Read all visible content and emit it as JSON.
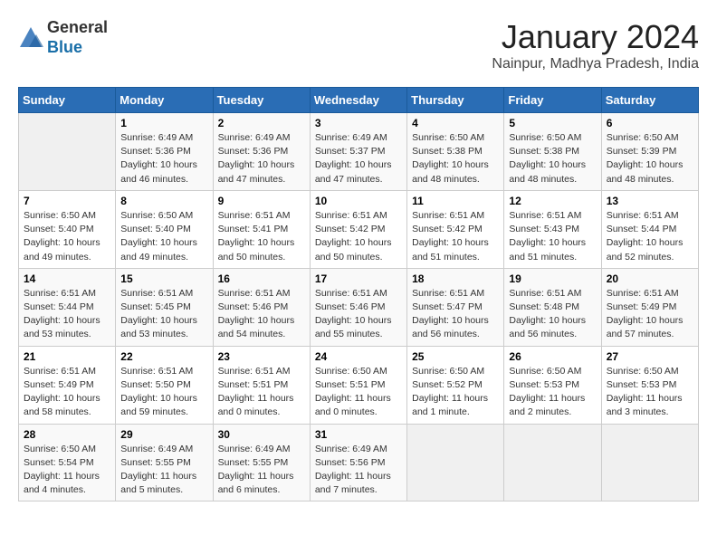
{
  "header": {
    "logo": {
      "line1": "General",
      "line2": "Blue"
    },
    "title": "January 2024",
    "location": "Nainpur, Madhya Pradesh, India"
  },
  "columns": [
    "Sunday",
    "Monday",
    "Tuesday",
    "Wednesday",
    "Thursday",
    "Friday",
    "Saturday"
  ],
  "weeks": [
    [
      {
        "day": "",
        "sunrise": "",
        "sunset": "",
        "daylight": ""
      },
      {
        "day": "1",
        "sunrise": "Sunrise: 6:49 AM",
        "sunset": "Sunset: 5:36 PM",
        "daylight": "Daylight: 10 hours and 46 minutes."
      },
      {
        "day": "2",
        "sunrise": "Sunrise: 6:49 AM",
        "sunset": "Sunset: 5:36 PM",
        "daylight": "Daylight: 10 hours and 47 minutes."
      },
      {
        "day": "3",
        "sunrise": "Sunrise: 6:49 AM",
        "sunset": "Sunset: 5:37 PM",
        "daylight": "Daylight: 10 hours and 47 minutes."
      },
      {
        "day": "4",
        "sunrise": "Sunrise: 6:50 AM",
        "sunset": "Sunset: 5:38 PM",
        "daylight": "Daylight: 10 hours and 48 minutes."
      },
      {
        "day": "5",
        "sunrise": "Sunrise: 6:50 AM",
        "sunset": "Sunset: 5:38 PM",
        "daylight": "Daylight: 10 hours and 48 minutes."
      },
      {
        "day": "6",
        "sunrise": "Sunrise: 6:50 AM",
        "sunset": "Sunset: 5:39 PM",
        "daylight": "Daylight: 10 hours and 48 minutes."
      }
    ],
    [
      {
        "day": "7",
        "sunrise": "Sunrise: 6:50 AM",
        "sunset": "Sunset: 5:40 PM",
        "daylight": "Daylight: 10 hours and 49 minutes."
      },
      {
        "day": "8",
        "sunrise": "Sunrise: 6:50 AM",
        "sunset": "Sunset: 5:40 PM",
        "daylight": "Daylight: 10 hours and 49 minutes."
      },
      {
        "day": "9",
        "sunrise": "Sunrise: 6:51 AM",
        "sunset": "Sunset: 5:41 PM",
        "daylight": "Daylight: 10 hours and 50 minutes."
      },
      {
        "day": "10",
        "sunrise": "Sunrise: 6:51 AM",
        "sunset": "Sunset: 5:42 PM",
        "daylight": "Daylight: 10 hours and 50 minutes."
      },
      {
        "day": "11",
        "sunrise": "Sunrise: 6:51 AM",
        "sunset": "Sunset: 5:42 PM",
        "daylight": "Daylight: 10 hours and 51 minutes."
      },
      {
        "day": "12",
        "sunrise": "Sunrise: 6:51 AM",
        "sunset": "Sunset: 5:43 PM",
        "daylight": "Daylight: 10 hours and 51 minutes."
      },
      {
        "day": "13",
        "sunrise": "Sunrise: 6:51 AM",
        "sunset": "Sunset: 5:44 PM",
        "daylight": "Daylight: 10 hours and 52 minutes."
      }
    ],
    [
      {
        "day": "14",
        "sunrise": "Sunrise: 6:51 AM",
        "sunset": "Sunset: 5:44 PM",
        "daylight": "Daylight: 10 hours and 53 minutes."
      },
      {
        "day": "15",
        "sunrise": "Sunrise: 6:51 AM",
        "sunset": "Sunset: 5:45 PM",
        "daylight": "Daylight: 10 hours and 53 minutes."
      },
      {
        "day": "16",
        "sunrise": "Sunrise: 6:51 AM",
        "sunset": "Sunset: 5:46 PM",
        "daylight": "Daylight: 10 hours and 54 minutes."
      },
      {
        "day": "17",
        "sunrise": "Sunrise: 6:51 AM",
        "sunset": "Sunset: 5:46 PM",
        "daylight": "Daylight: 10 hours and 55 minutes."
      },
      {
        "day": "18",
        "sunrise": "Sunrise: 6:51 AM",
        "sunset": "Sunset: 5:47 PM",
        "daylight": "Daylight: 10 hours and 56 minutes."
      },
      {
        "day": "19",
        "sunrise": "Sunrise: 6:51 AM",
        "sunset": "Sunset: 5:48 PM",
        "daylight": "Daylight: 10 hours and 56 minutes."
      },
      {
        "day": "20",
        "sunrise": "Sunrise: 6:51 AM",
        "sunset": "Sunset: 5:49 PM",
        "daylight": "Daylight: 10 hours and 57 minutes."
      }
    ],
    [
      {
        "day": "21",
        "sunrise": "Sunrise: 6:51 AM",
        "sunset": "Sunset: 5:49 PM",
        "daylight": "Daylight: 10 hours and 58 minutes."
      },
      {
        "day": "22",
        "sunrise": "Sunrise: 6:51 AM",
        "sunset": "Sunset: 5:50 PM",
        "daylight": "Daylight: 10 hours and 59 minutes."
      },
      {
        "day": "23",
        "sunrise": "Sunrise: 6:51 AM",
        "sunset": "Sunset: 5:51 PM",
        "daylight": "Daylight: 11 hours and 0 minutes."
      },
      {
        "day": "24",
        "sunrise": "Sunrise: 6:50 AM",
        "sunset": "Sunset: 5:51 PM",
        "daylight": "Daylight: 11 hours and 0 minutes."
      },
      {
        "day": "25",
        "sunrise": "Sunrise: 6:50 AM",
        "sunset": "Sunset: 5:52 PM",
        "daylight": "Daylight: 11 hours and 1 minute."
      },
      {
        "day": "26",
        "sunrise": "Sunrise: 6:50 AM",
        "sunset": "Sunset: 5:53 PM",
        "daylight": "Daylight: 11 hours and 2 minutes."
      },
      {
        "day": "27",
        "sunrise": "Sunrise: 6:50 AM",
        "sunset": "Sunset: 5:53 PM",
        "daylight": "Daylight: 11 hours and 3 minutes."
      }
    ],
    [
      {
        "day": "28",
        "sunrise": "Sunrise: 6:50 AM",
        "sunset": "Sunset: 5:54 PM",
        "daylight": "Daylight: 11 hours and 4 minutes."
      },
      {
        "day": "29",
        "sunrise": "Sunrise: 6:49 AM",
        "sunset": "Sunset: 5:55 PM",
        "daylight": "Daylight: 11 hours and 5 minutes."
      },
      {
        "day": "30",
        "sunrise": "Sunrise: 6:49 AM",
        "sunset": "Sunset: 5:55 PM",
        "daylight": "Daylight: 11 hours and 6 minutes."
      },
      {
        "day": "31",
        "sunrise": "Sunrise: 6:49 AM",
        "sunset": "Sunset: 5:56 PM",
        "daylight": "Daylight: 11 hours and 7 minutes."
      },
      {
        "day": "",
        "sunrise": "",
        "sunset": "",
        "daylight": ""
      },
      {
        "day": "",
        "sunrise": "",
        "sunset": "",
        "daylight": ""
      },
      {
        "day": "",
        "sunrise": "",
        "sunset": "",
        "daylight": ""
      }
    ]
  ]
}
